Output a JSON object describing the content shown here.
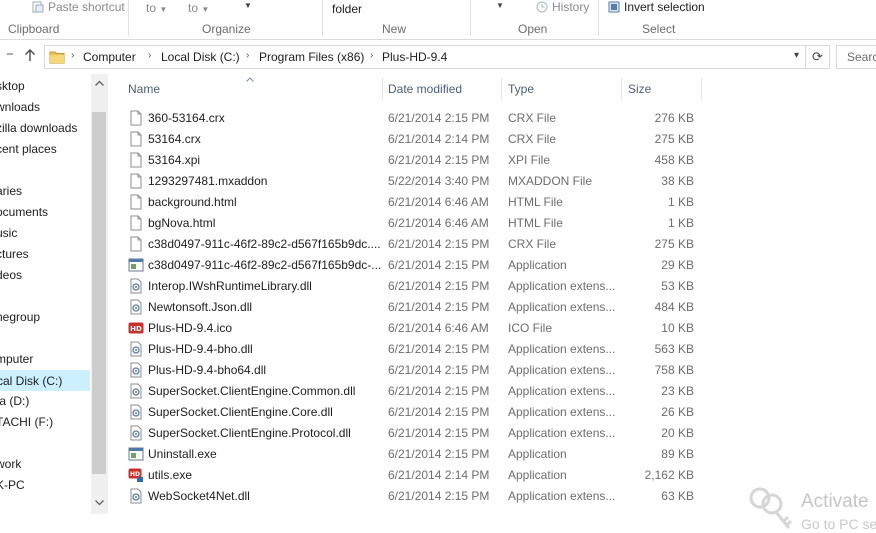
{
  "ribbon": {
    "paste_shortcut": "Paste shortcut",
    "move_to": "to",
    "copy_to": "to",
    "new_folder": "folder",
    "history": "History",
    "invert_selection": "Invert selection",
    "groups": {
      "clipboard": "Clipboard",
      "organize": "Organize",
      "new": "New",
      "open": "Open",
      "select": "Select"
    }
  },
  "address": {
    "crumbs": [
      "Computer",
      "Local Disk (C:)",
      "Program Files (x86)",
      "Plus-HD-9.4"
    ]
  },
  "search": {
    "placeholder": "Searc"
  },
  "nav": {
    "items": [
      "sktop",
      "wnloads",
      "zilla downloads",
      "cent places",
      "aries",
      "ocuments",
      "usic",
      "ctures",
      "deos",
      "negroup",
      "mputer",
      "cal Disk (C:)",
      "ta (D:)",
      "TACHI (F:)",
      "work",
      "K-PC"
    ],
    "selected": "cal Disk (C:)"
  },
  "columns": {
    "name": "Name",
    "date": "Date modified",
    "type": "Type",
    "size": "Size"
  },
  "files": [
    {
      "name": "360-53164.crx",
      "date": "6/21/2014 2:15 PM",
      "type": "CRX File",
      "size": "276 KB",
      "icon": "blank-file-icon"
    },
    {
      "name": "53164.crx",
      "date": "6/21/2014 2:14 PM",
      "type": "CRX File",
      "size": "275 KB",
      "icon": "blank-file-icon"
    },
    {
      "name": "53164.xpi",
      "date": "6/21/2014 2:15 PM",
      "type": "XPI File",
      "size": "458 KB",
      "icon": "blank-file-icon"
    },
    {
      "name": "1293297481.mxaddon",
      "date": "5/22/2014 3:40 PM",
      "type": "MXADDON File",
      "size": "38 KB",
      "icon": "blank-file-icon"
    },
    {
      "name": "background.html",
      "date": "6/21/2014 6:46 AM",
      "type": "HTML File",
      "size": "1 KB",
      "icon": "blank-file-icon"
    },
    {
      "name": "bgNova.html",
      "date": "6/21/2014 6:46 AM",
      "type": "HTML File",
      "size": "1 KB",
      "icon": "blank-file-icon"
    },
    {
      "name": "c38d0497-911c-46f2-89c2-d567f165b9dc....",
      "date": "6/21/2014 2:15 PM",
      "type": "CRX File",
      "size": "275 KB",
      "icon": "blank-file-icon"
    },
    {
      "name": "c38d0497-911c-46f2-89c2-d567f165b9dc-...",
      "date": "6/21/2014 2:15 PM",
      "type": "Application",
      "size": "29 KB",
      "icon": "application-icon"
    },
    {
      "name": "Interop.IWshRuntimeLibrary.dll",
      "date": "6/21/2014 2:15 PM",
      "type": "Application extens...",
      "size": "53 KB",
      "icon": "dll-icon"
    },
    {
      "name": "Newtonsoft.Json.dll",
      "date": "6/21/2014 2:15 PM",
      "type": "Application extens...",
      "size": "484 KB",
      "icon": "dll-icon"
    },
    {
      "name": "Plus-HD-9.4.ico",
      "date": "6/21/2014 6:46 AM",
      "type": "ICO File",
      "size": "10 KB",
      "icon": "hd-icon"
    },
    {
      "name": "Plus-HD-9.4-bho.dll",
      "date": "6/21/2014 2:15 PM",
      "type": "Application extens...",
      "size": "563 KB",
      "icon": "dll-icon"
    },
    {
      "name": "Plus-HD-9.4-bho64.dll",
      "date": "6/21/2014 2:15 PM",
      "type": "Application extens...",
      "size": "758 KB",
      "icon": "dll-icon"
    },
    {
      "name": "SuperSocket.ClientEngine.Common.dll",
      "date": "6/21/2014 2:15 PM",
      "type": "Application extens...",
      "size": "23 KB",
      "icon": "dll-icon"
    },
    {
      "name": "SuperSocket.ClientEngine.Core.dll",
      "date": "6/21/2014 2:15 PM",
      "type": "Application extens...",
      "size": "26 KB",
      "icon": "dll-icon"
    },
    {
      "name": "SuperSocket.ClientEngine.Protocol.dll",
      "date": "6/21/2014 2:15 PM",
      "type": "Application extens...",
      "size": "20 KB",
      "icon": "dll-icon"
    },
    {
      "name": "Uninstall.exe",
      "date": "6/21/2014 2:15 PM",
      "type": "Application",
      "size": "89 KB",
      "icon": "application-icon"
    },
    {
      "name": "utils.exe",
      "date": "6/21/2014 2:14 PM",
      "type": "Application",
      "size": "2,162 KB",
      "icon": "hd-exe-icon"
    },
    {
      "name": "WebSocket4Net.dll",
      "date": "6/21/2014 2:15 PM",
      "type": "Application extens...",
      "size": "63 KB",
      "icon": "dll-icon"
    }
  ],
  "watermark": {
    "line1": "Activate",
    "line2": "Go to PC se"
  },
  "colors": {
    "selection": "#ccf0ff",
    "header_text": "#4c607a",
    "hd_icon_red": "#c8302c"
  }
}
